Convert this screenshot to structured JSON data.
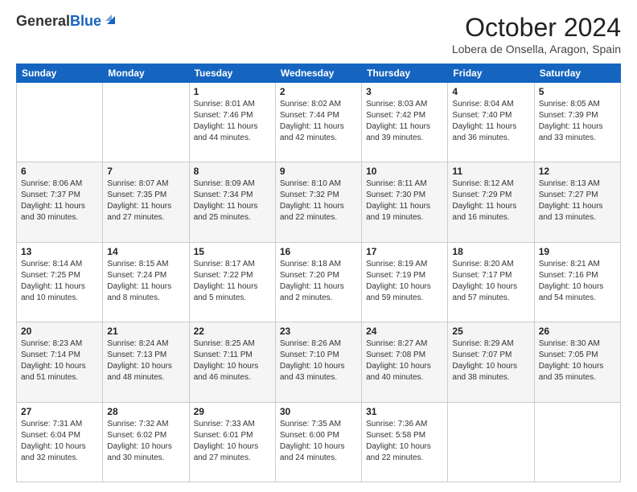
{
  "header": {
    "logo_general": "General",
    "logo_blue": "Blue",
    "title": "October 2024",
    "location": "Lobera de Onsella, Aragon, Spain"
  },
  "days_of_week": [
    "Sunday",
    "Monday",
    "Tuesday",
    "Wednesday",
    "Thursday",
    "Friday",
    "Saturday"
  ],
  "weeks": [
    [
      {
        "day": null
      },
      {
        "day": null
      },
      {
        "day": "1",
        "sunrise": "Sunrise: 8:01 AM",
        "sunset": "Sunset: 7:46 PM",
        "daylight": "Daylight: 11 hours and 44 minutes."
      },
      {
        "day": "2",
        "sunrise": "Sunrise: 8:02 AM",
        "sunset": "Sunset: 7:44 PM",
        "daylight": "Daylight: 11 hours and 42 minutes."
      },
      {
        "day": "3",
        "sunrise": "Sunrise: 8:03 AM",
        "sunset": "Sunset: 7:42 PM",
        "daylight": "Daylight: 11 hours and 39 minutes."
      },
      {
        "day": "4",
        "sunrise": "Sunrise: 8:04 AM",
        "sunset": "Sunset: 7:40 PM",
        "daylight": "Daylight: 11 hours and 36 minutes."
      },
      {
        "day": "5",
        "sunrise": "Sunrise: 8:05 AM",
        "sunset": "Sunset: 7:39 PM",
        "daylight": "Daylight: 11 hours and 33 minutes."
      }
    ],
    [
      {
        "day": "6",
        "sunrise": "Sunrise: 8:06 AM",
        "sunset": "Sunset: 7:37 PM",
        "daylight": "Daylight: 11 hours and 30 minutes."
      },
      {
        "day": "7",
        "sunrise": "Sunrise: 8:07 AM",
        "sunset": "Sunset: 7:35 PM",
        "daylight": "Daylight: 11 hours and 27 minutes."
      },
      {
        "day": "8",
        "sunrise": "Sunrise: 8:09 AM",
        "sunset": "Sunset: 7:34 PM",
        "daylight": "Daylight: 11 hours and 25 minutes."
      },
      {
        "day": "9",
        "sunrise": "Sunrise: 8:10 AM",
        "sunset": "Sunset: 7:32 PM",
        "daylight": "Daylight: 11 hours and 22 minutes."
      },
      {
        "day": "10",
        "sunrise": "Sunrise: 8:11 AM",
        "sunset": "Sunset: 7:30 PM",
        "daylight": "Daylight: 11 hours and 19 minutes."
      },
      {
        "day": "11",
        "sunrise": "Sunrise: 8:12 AM",
        "sunset": "Sunset: 7:29 PM",
        "daylight": "Daylight: 11 hours and 16 minutes."
      },
      {
        "day": "12",
        "sunrise": "Sunrise: 8:13 AM",
        "sunset": "Sunset: 7:27 PM",
        "daylight": "Daylight: 11 hours and 13 minutes."
      }
    ],
    [
      {
        "day": "13",
        "sunrise": "Sunrise: 8:14 AM",
        "sunset": "Sunset: 7:25 PM",
        "daylight": "Daylight: 11 hours and 10 minutes."
      },
      {
        "day": "14",
        "sunrise": "Sunrise: 8:15 AM",
        "sunset": "Sunset: 7:24 PM",
        "daylight": "Daylight: 11 hours and 8 minutes."
      },
      {
        "day": "15",
        "sunrise": "Sunrise: 8:17 AM",
        "sunset": "Sunset: 7:22 PM",
        "daylight": "Daylight: 11 hours and 5 minutes."
      },
      {
        "day": "16",
        "sunrise": "Sunrise: 8:18 AM",
        "sunset": "Sunset: 7:20 PM",
        "daylight": "Daylight: 11 hours and 2 minutes."
      },
      {
        "day": "17",
        "sunrise": "Sunrise: 8:19 AM",
        "sunset": "Sunset: 7:19 PM",
        "daylight": "Daylight: 10 hours and 59 minutes."
      },
      {
        "day": "18",
        "sunrise": "Sunrise: 8:20 AM",
        "sunset": "Sunset: 7:17 PM",
        "daylight": "Daylight: 10 hours and 57 minutes."
      },
      {
        "day": "19",
        "sunrise": "Sunrise: 8:21 AM",
        "sunset": "Sunset: 7:16 PM",
        "daylight": "Daylight: 10 hours and 54 minutes."
      }
    ],
    [
      {
        "day": "20",
        "sunrise": "Sunrise: 8:23 AM",
        "sunset": "Sunset: 7:14 PM",
        "daylight": "Daylight: 10 hours and 51 minutes."
      },
      {
        "day": "21",
        "sunrise": "Sunrise: 8:24 AM",
        "sunset": "Sunset: 7:13 PM",
        "daylight": "Daylight: 10 hours and 48 minutes."
      },
      {
        "day": "22",
        "sunrise": "Sunrise: 8:25 AM",
        "sunset": "Sunset: 7:11 PM",
        "daylight": "Daylight: 10 hours and 46 minutes."
      },
      {
        "day": "23",
        "sunrise": "Sunrise: 8:26 AM",
        "sunset": "Sunset: 7:10 PM",
        "daylight": "Daylight: 10 hours and 43 minutes."
      },
      {
        "day": "24",
        "sunrise": "Sunrise: 8:27 AM",
        "sunset": "Sunset: 7:08 PM",
        "daylight": "Daylight: 10 hours and 40 minutes."
      },
      {
        "day": "25",
        "sunrise": "Sunrise: 8:29 AM",
        "sunset": "Sunset: 7:07 PM",
        "daylight": "Daylight: 10 hours and 38 minutes."
      },
      {
        "day": "26",
        "sunrise": "Sunrise: 8:30 AM",
        "sunset": "Sunset: 7:05 PM",
        "daylight": "Daylight: 10 hours and 35 minutes."
      }
    ],
    [
      {
        "day": "27",
        "sunrise": "Sunrise: 7:31 AM",
        "sunset": "Sunset: 6:04 PM",
        "daylight": "Daylight: 10 hours and 32 minutes."
      },
      {
        "day": "28",
        "sunrise": "Sunrise: 7:32 AM",
        "sunset": "Sunset: 6:02 PM",
        "daylight": "Daylight: 10 hours and 30 minutes."
      },
      {
        "day": "29",
        "sunrise": "Sunrise: 7:33 AM",
        "sunset": "Sunset: 6:01 PM",
        "daylight": "Daylight: 10 hours and 27 minutes."
      },
      {
        "day": "30",
        "sunrise": "Sunrise: 7:35 AM",
        "sunset": "Sunset: 6:00 PM",
        "daylight": "Daylight: 10 hours and 24 minutes."
      },
      {
        "day": "31",
        "sunrise": "Sunrise: 7:36 AM",
        "sunset": "Sunset: 5:58 PM",
        "daylight": "Daylight: 10 hours and 22 minutes."
      },
      {
        "day": null
      },
      {
        "day": null
      }
    ]
  ]
}
